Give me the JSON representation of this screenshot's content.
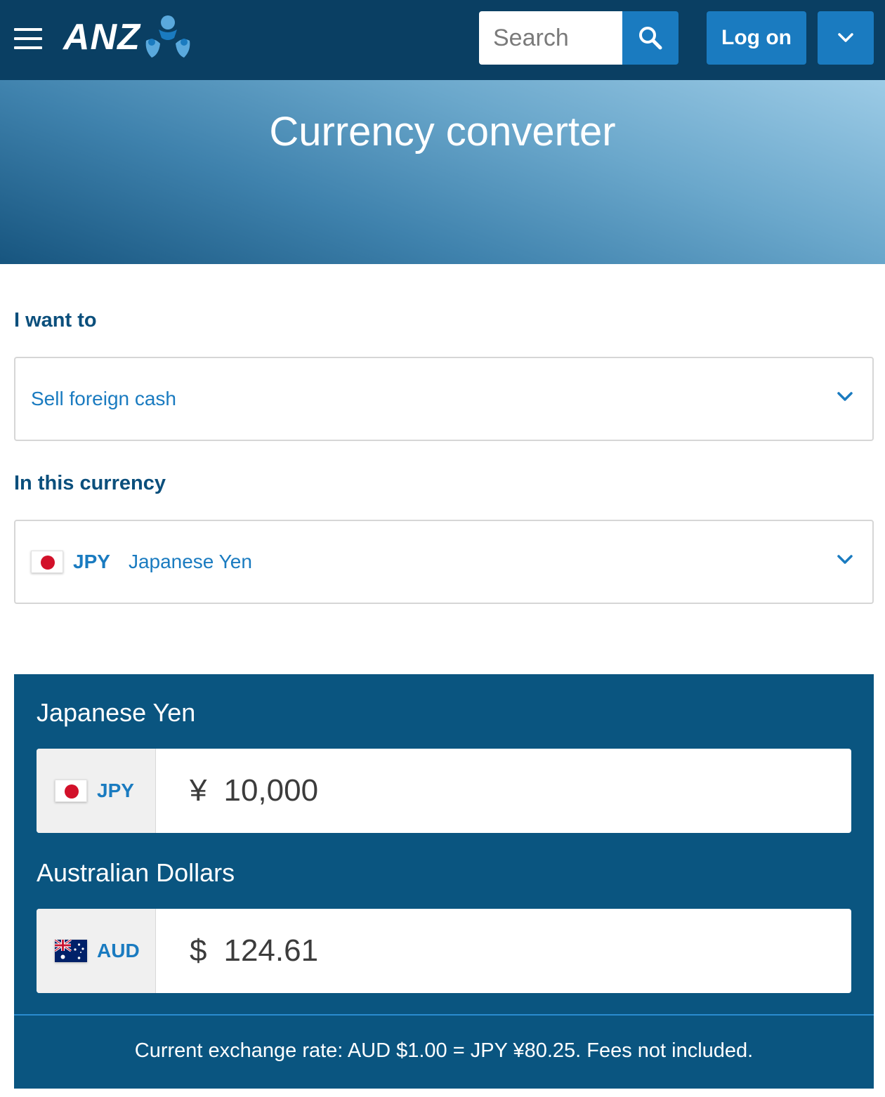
{
  "header": {
    "logo_text": "ANZ",
    "search_placeholder": "Search",
    "logon_label": "Log on",
    "brand_color": "#0a3f63",
    "accent_color": "#1a7bc0"
  },
  "hero": {
    "title": "Currency converter"
  },
  "form": {
    "action_label": "I want to",
    "action_value": "Sell foreign cash",
    "currency_label": "In this currency",
    "currency_code": "JPY",
    "currency_name": "Japanese Yen"
  },
  "converter": {
    "from_title": "Japanese Yen",
    "from_code": "JPY",
    "from_symbol": "¥",
    "from_amount": "10,000",
    "to_title": "Australian Dollars",
    "to_code": "AUD",
    "to_symbol": "$",
    "to_amount": "124.61",
    "rate_text": "Current exchange rate: AUD $1.00 = JPY ¥80.25. Fees not included."
  },
  "icons": {
    "menu": "hamburger-icon",
    "search": "search-icon",
    "dropdown": "chevron-down-icon",
    "flag_jp": "japan-flag-icon",
    "flag_au": "australia-flag-icon"
  }
}
